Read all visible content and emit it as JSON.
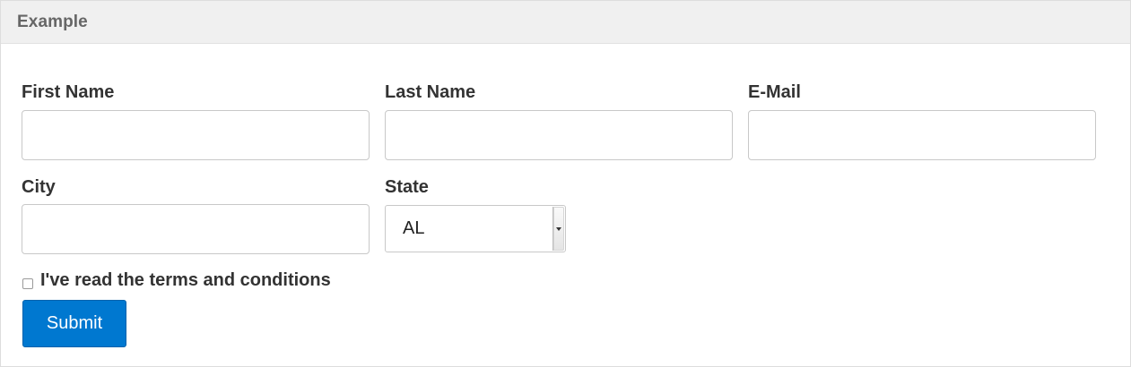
{
  "panel": {
    "title": "Example"
  },
  "form": {
    "first_name": {
      "label": "First Name",
      "value": ""
    },
    "last_name": {
      "label": "Last Name",
      "value": ""
    },
    "email": {
      "label": "E-Mail",
      "value": ""
    },
    "city": {
      "label": "City",
      "value": ""
    },
    "state": {
      "label": "State",
      "selected": "AL"
    },
    "terms": {
      "label": "I've read the terms and conditions",
      "checked": false
    },
    "submit_label": "Submit"
  },
  "colors": {
    "header_bg": "#f0f0f0",
    "button_bg": "#0078d0",
    "label_text": "#333333",
    "input_border": "#c8c8c8"
  }
}
